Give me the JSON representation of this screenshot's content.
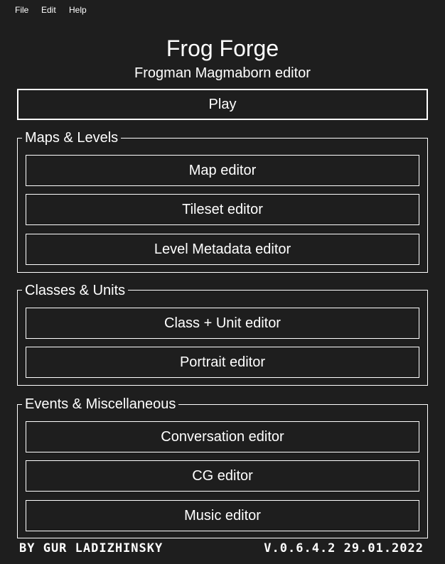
{
  "menu": {
    "file": "File",
    "edit": "Edit",
    "help": "Help"
  },
  "header": {
    "title": "Frog Forge",
    "subtitle": "Frogman Magmaborn editor"
  },
  "play_label": "Play",
  "groups": {
    "maps": {
      "title": "Maps & Levels",
      "buttons": [
        "Map editor",
        "Tileset editor",
        "Level Metadata editor"
      ]
    },
    "classes": {
      "title": "Classes & Units",
      "buttons": [
        "Class + Unit editor",
        "Portrait editor"
      ]
    },
    "events": {
      "title": "Events & Miscellaneous",
      "buttons": [
        "Conversation editor",
        "CG editor",
        "Music editor"
      ]
    }
  },
  "footer": {
    "author": "BY GUR LADIZHINSKY",
    "version": "V.0.6.4.2 29.01.2022"
  },
  "colors": {
    "background": "#1e1e1e",
    "foreground": "#ffffff"
  }
}
